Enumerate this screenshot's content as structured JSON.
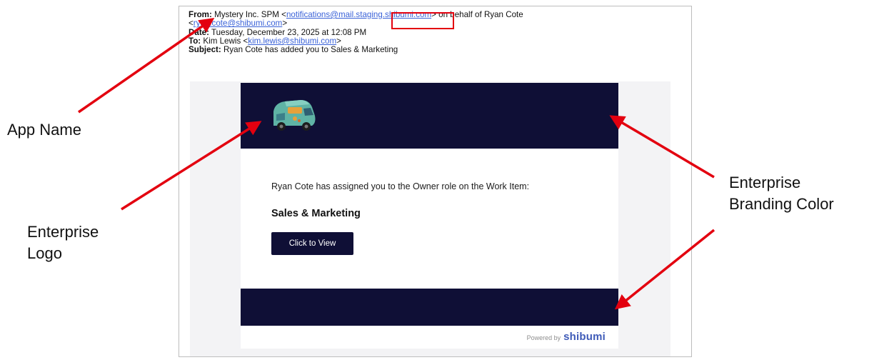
{
  "email_headers": {
    "from_label": "From:",
    "from_name": "Mystery Inc. SPM",
    "from_email_open": "<",
    "from_email": "notifications@mail.staging.shibumi.com",
    "from_email_close": ">",
    "on_behalf_text": "on behalf of Ryan Cote",
    "behalf_email_open": "<",
    "behalf_email": "ryan.cote@shibumi.com",
    "behalf_email_close": ">",
    "date_label": "Date:",
    "date_value": "Tuesday, December 23, 2025 at 12:08 PM",
    "to_label": "To:",
    "to_name": "Kim Lewis",
    "to_email_open": "<",
    "to_email": "kim.lewis@shibumi.com",
    "to_email_close": ">",
    "subject_label": "Subject:",
    "subject_value": "Ryan Cote has added you to Sales & Marketing"
  },
  "email_body": {
    "assigned_text": "Ryan Cote has assigned you to the Owner role on the Work Item:",
    "work_item": "Sales & Marketing",
    "view_button": "Click to View",
    "powered_by": "Powered by",
    "powered_brand": "shibumi"
  },
  "callouts": {
    "app_name": "App Name",
    "enterprise_logo": [
      "Enterprise",
      "Logo"
    ],
    "branding_color": [
      "Enterprise",
      "Branding Color"
    ]
  },
  "colors": {
    "brand_navy": "#0f0f36",
    "annotation_red": "#e3000f",
    "link_blue": "#3a62d8"
  },
  "icons": [
    "van-logo-icon",
    "red-arrow"
  ]
}
